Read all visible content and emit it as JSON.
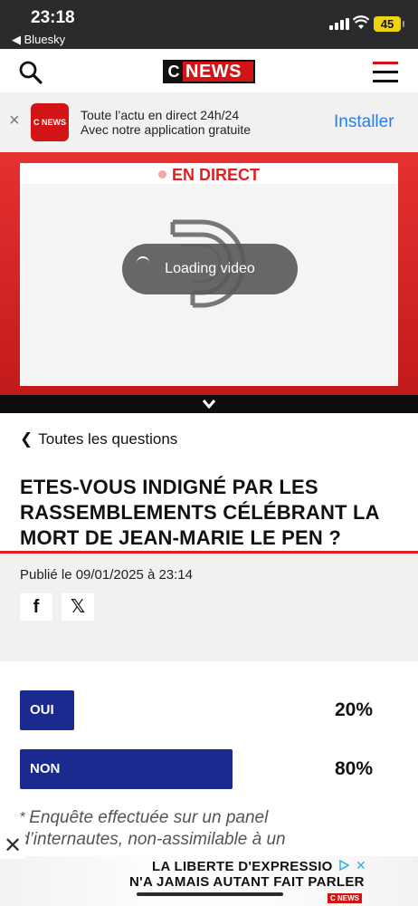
{
  "status_bar": {
    "time": "23:18",
    "back_app": "◀ Bluesky",
    "battery": "45"
  },
  "header": {
    "logo_c": "C",
    "logo_text": "NEWS"
  },
  "app_banner": {
    "close": "×",
    "app_icon_text": "C NEWS",
    "line1": "Toute l’actu en direct 24h/24",
    "line2": "Avec notre application gratuite",
    "install": "Installer"
  },
  "video": {
    "live_label": "EN DIRECT",
    "loading_text": "Loading video"
  },
  "article": {
    "back_label": "Toutes les questions",
    "title": "ETES-VOUS INDIGNÉ PAR LES RASSEMBLEMENTS CÉLÉBRANT LA MORT DE JEAN-MARIE LE PEN ?",
    "published": "Publié le 09/01/2025 à 23:14",
    "share_facebook": "f",
    "share_x": "𝕏"
  },
  "poll": {
    "options": [
      {
        "label": "OUI",
        "percent_text": "20%",
        "fraction": 0.2
      },
      {
        "label": "NON",
        "percent_text": "80%",
        "fraction": 0.8
      }
    ],
    "disclaimer_star": "*",
    "disclaimer_line1": "Enquête effectuée sur un panel",
    "disclaimer_line2": "d’internautes, non-assimilable à un"
  },
  "ad": {
    "close": "✕",
    "line1": "LA LIBERTE D'EXPRESSIO",
    "line2": "N'A JAMAIS AUTANT FAIT PARLER",
    "brand": "C NEWS"
  },
  "colors": {
    "brand_red": "#d21417",
    "poll_blue": "#1a2a8f",
    "link_blue": "#2a7de1"
  }
}
